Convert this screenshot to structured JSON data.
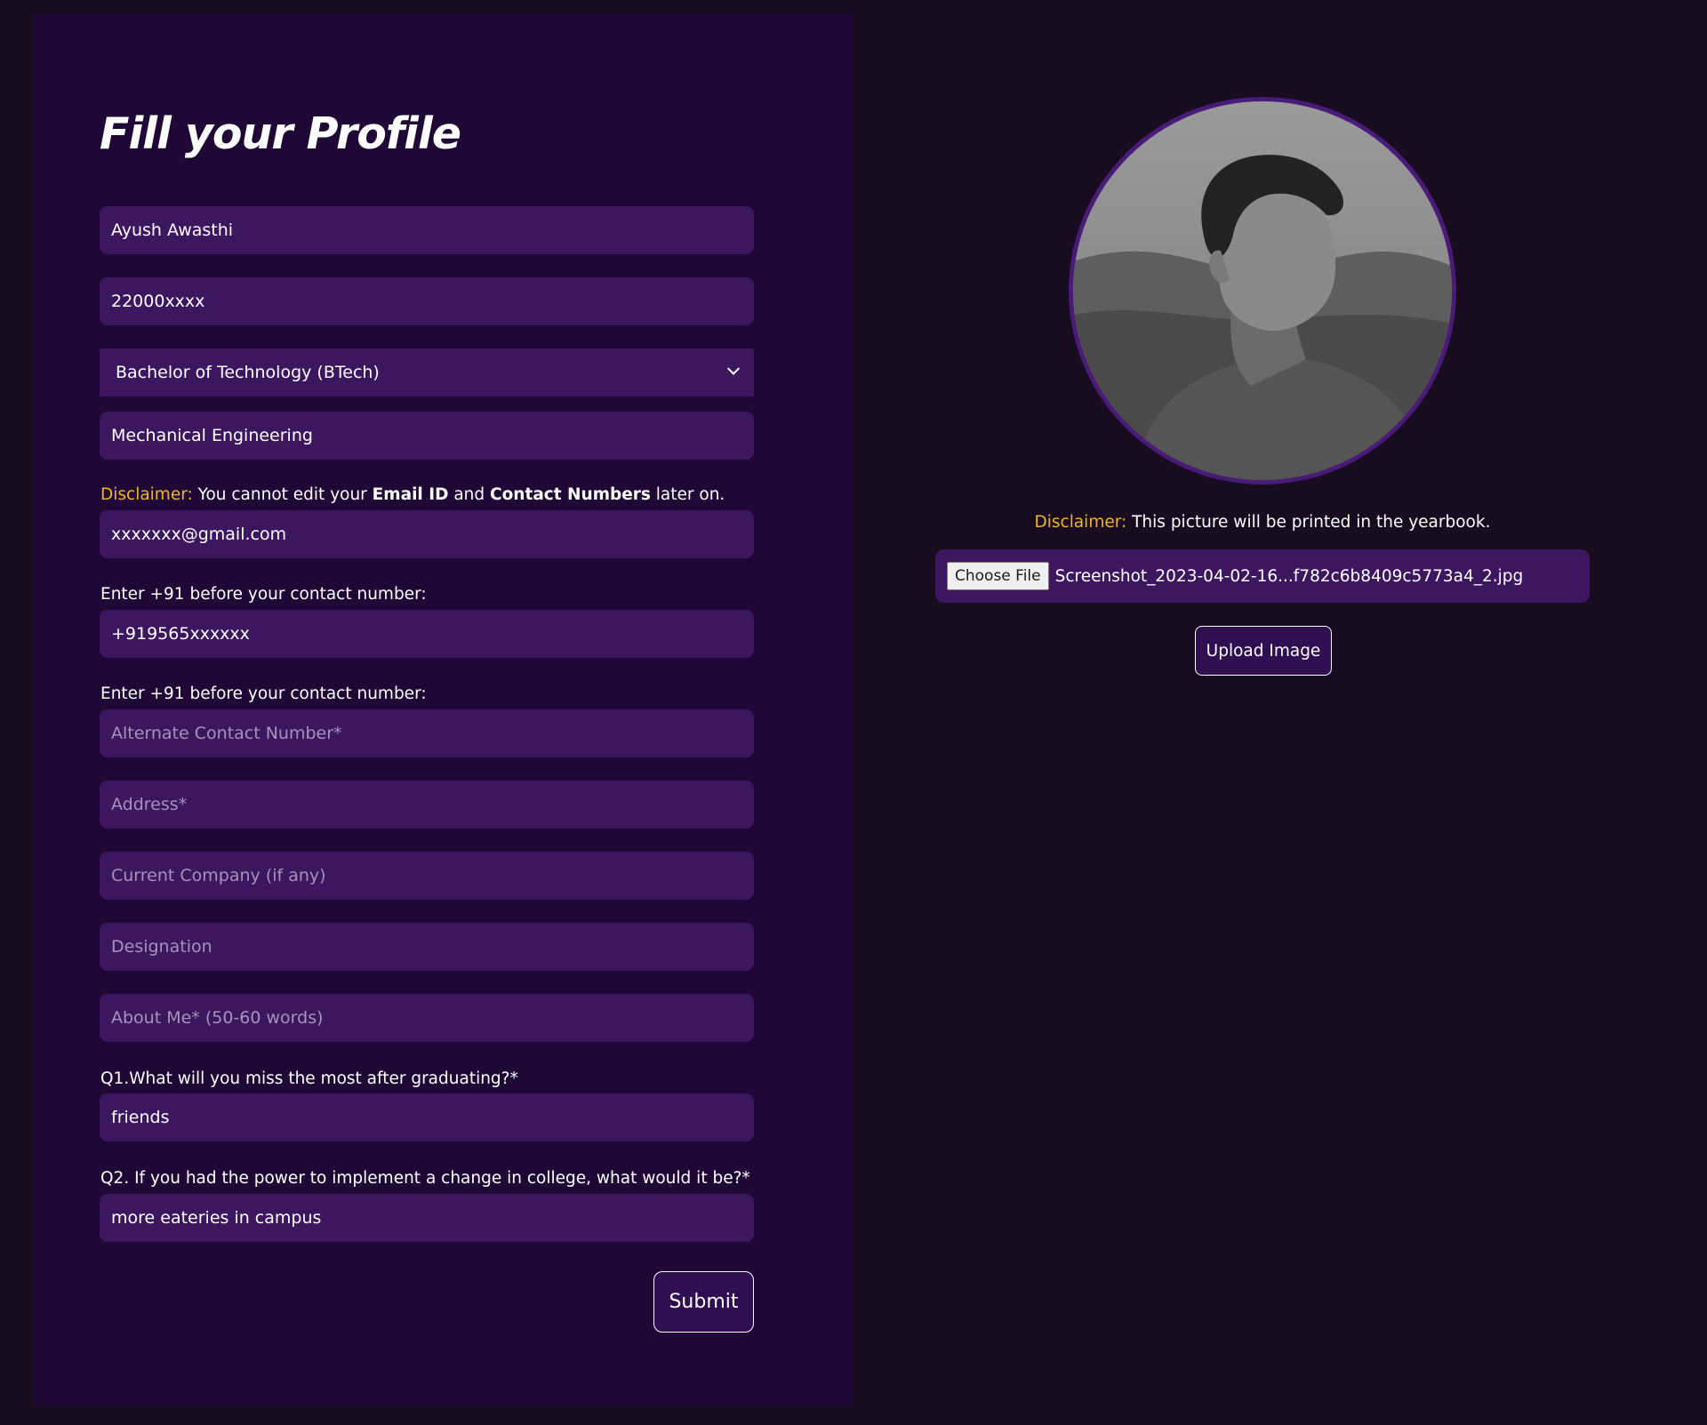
{
  "form": {
    "title": "Fill your Profile",
    "name": "Ayush Awasthi",
    "roll_number": "22000xxxx",
    "program": "Bachelor of Technology (BTech)",
    "branch": "Mechanical Engineering",
    "disclaimer": {
      "prefix": "Disclaimer:",
      "text1": " You cannot edit your ",
      "bold1": "Email ID",
      "text2": " and ",
      "bold2": "Contact Numbers",
      "text3": " later on."
    },
    "email": "xxxxxxx@gmail.com",
    "contact_hint_1": "Enter +91 before your contact number:",
    "contact_number": "+919565xxxxxx",
    "contact_hint_2": "Enter +91 before your contact number:",
    "alternate_contact_placeholder": "Alternate Contact Number*",
    "address_placeholder": "Address*",
    "company_placeholder": "Current Company (if any)",
    "designation_placeholder": "Designation",
    "about_placeholder": "About Me* (50-60 words)",
    "q1_label": "Q1.What will you miss the most after graduating?*",
    "q1_answer": "friends",
    "q2_label": "Q2. If you had the power to implement a change in college, what would it be?*",
    "q2_answer": "more eateries in campus",
    "submit_label": "Submit"
  },
  "photo": {
    "disclaimer_prefix": "Disclaimer:",
    "disclaimer_text": " This picture will be printed in the yearbook.",
    "choose_file_label": "Choose File",
    "file_name": "Screenshot_2023-04-02-16...f782c6b8409c5773a4_2.jpg",
    "upload_label": "Upload Image"
  },
  "colors": {
    "page_background": "#170c20",
    "panel_background": "#1f0836",
    "field_background": "#3d1660",
    "accent": "#f0b41e",
    "avatar_ring": "#4a1a78"
  }
}
